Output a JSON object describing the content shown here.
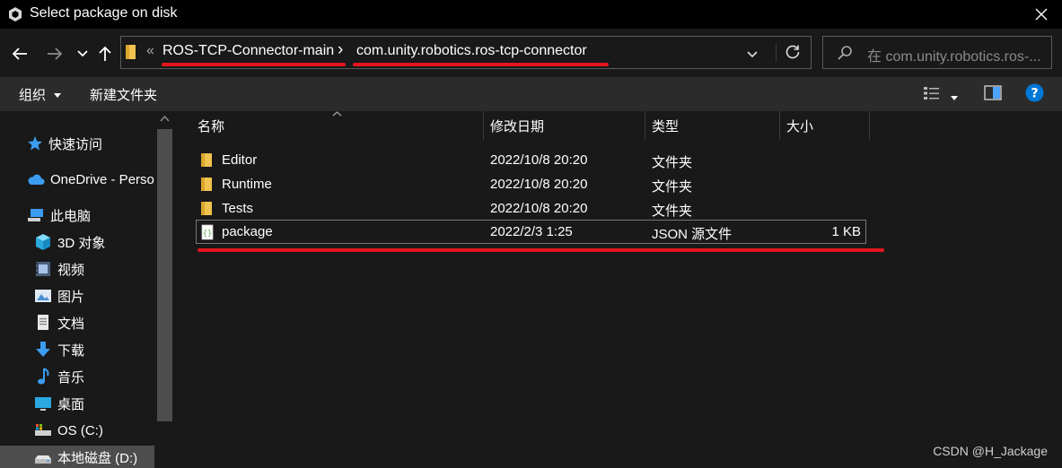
{
  "window": {
    "title": "Select package on disk",
    "close_icon": "close-icon"
  },
  "address": {
    "overflow": "«",
    "crumbs": [
      "ROS-TCP-Connector-main",
      "com.unity.robotics.ros-tcp-connector"
    ],
    "separator": "›"
  },
  "search": {
    "placeholder": "在 com.unity.robotics.ros-..."
  },
  "toolbar": {
    "organize": "组织",
    "new_folder": "新建文件夹"
  },
  "sidebar": {
    "items": [
      {
        "label": "快速访问",
        "icon": "star-icon"
      },
      {
        "label": "OneDrive - Perso",
        "icon": "cloud-icon"
      },
      {
        "label": "此电脑",
        "icon": "pc-icon"
      },
      {
        "label": "3D 对象",
        "icon": "cube-icon"
      },
      {
        "label": "视频",
        "icon": "video-icon"
      },
      {
        "label": "图片",
        "icon": "picture-icon"
      },
      {
        "label": "文档",
        "icon": "document-icon"
      },
      {
        "label": "下载",
        "icon": "download-icon"
      },
      {
        "label": "音乐",
        "icon": "music-icon"
      },
      {
        "label": "桌面",
        "icon": "desktop-icon"
      },
      {
        "label": "OS (C:)",
        "icon": "drive-c-icon"
      },
      {
        "label": "本地磁盘 (D:)",
        "icon": "drive-d-icon"
      }
    ]
  },
  "columns": {
    "name": "名称",
    "modified": "修改日期",
    "type": "类型",
    "size": "大小"
  },
  "files": [
    {
      "name": "Editor",
      "modified": "2022/10/8 20:20",
      "type": "文件夹",
      "size": "",
      "icon": "folder-icon"
    },
    {
      "name": "Runtime",
      "modified": "2022/10/8 20:20",
      "type": "文件夹",
      "size": "",
      "icon": "folder-icon"
    },
    {
      "name": "Tests",
      "modified": "2022/10/8 20:20",
      "type": "文件夹",
      "size": "",
      "icon": "folder-icon"
    },
    {
      "name": "package",
      "modified": "2022/2/3 1:25",
      "type": "JSON 源文件",
      "size": "1 KB",
      "icon": "json-file-icon"
    }
  ],
  "watermark": "CSDN @H_Jackage",
  "colors": {
    "accent": "#0078d7",
    "annotation": "#e6141e",
    "folder": "#f0c34e"
  }
}
